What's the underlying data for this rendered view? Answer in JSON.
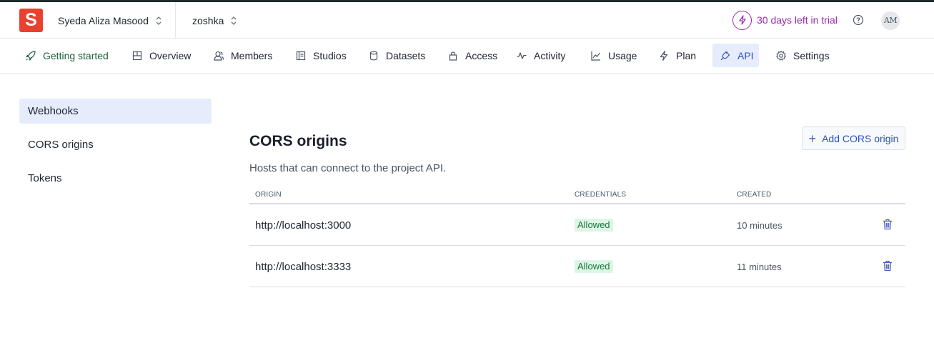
{
  "header": {
    "logo_letter": "S",
    "org_name": "Syeda Aliza Masood",
    "project_name": "zoshka",
    "trial_text": "30 days left in trial",
    "avatar_initials": "AM",
    "colors": {
      "logo": "#e9412f",
      "trial": "#9b27af",
      "accent": "#2b4fc3"
    }
  },
  "nav": {
    "tabs": [
      {
        "label": "Getting started",
        "icon": "rocket-icon"
      },
      {
        "label": "Overview",
        "icon": "layout-icon"
      },
      {
        "label": "Members",
        "icon": "members-icon"
      },
      {
        "label": "Studios",
        "icon": "studios-icon"
      },
      {
        "label": "Datasets",
        "icon": "database-icon"
      },
      {
        "label": "Access",
        "icon": "lock-icon"
      },
      {
        "label": "Activity",
        "icon": "activity-icon"
      },
      {
        "label": "Usage",
        "icon": "chart-icon"
      },
      {
        "label": "Plan",
        "icon": "bolt-icon"
      },
      {
        "label": "API",
        "icon": "plug-icon",
        "active": true
      },
      {
        "label": "Settings",
        "icon": "gear-icon"
      }
    ]
  },
  "sidebar": {
    "items": [
      {
        "label": "Webhooks",
        "active": true
      },
      {
        "label": "CORS origins"
      },
      {
        "label": "Tokens"
      }
    ]
  },
  "main": {
    "title": "CORS origins",
    "subtitle": "Hosts that can connect to the project API.",
    "add_button": "Add CORS origin",
    "columns": [
      "ORIGIN",
      "CREDENTIALS",
      "CREATED"
    ],
    "rows": [
      {
        "origin": "http://localhost:3000",
        "credentials": "Allowed",
        "created": "10 minutes"
      },
      {
        "origin": "http://localhost:3333",
        "credentials": "Allowed",
        "created": "11 minutes"
      }
    ]
  }
}
